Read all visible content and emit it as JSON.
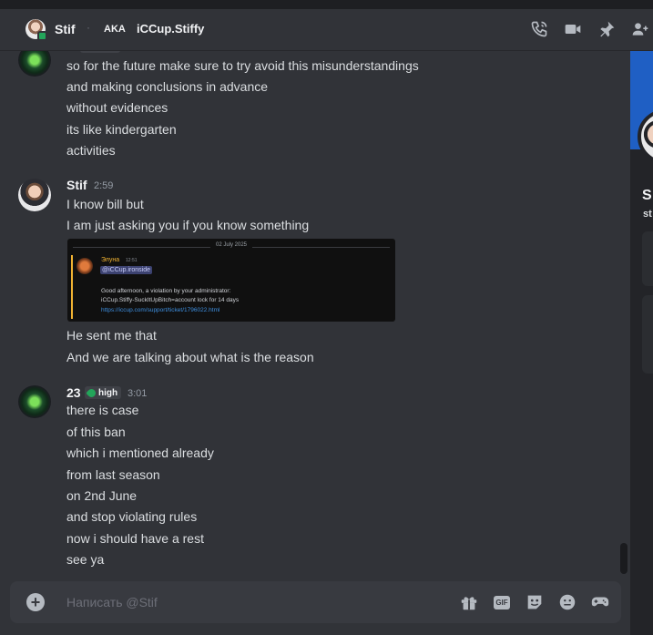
{
  "header": {
    "name": "Stif",
    "separator": "·",
    "aka": "AKA",
    "nickname": "iCCup.Stiffy",
    "icons": [
      "call-icon",
      "video-call-icon",
      "pin-icon",
      "add-friends-icon"
    ]
  },
  "chat": {
    "earlier_lines": [
      "so for the future make sure to try avoid this misunderstandings",
      "and making conclusions in advance",
      "without evidences",
      "its like kindergarten",
      "activities"
    ],
    "stif_message": {
      "author": "Stif",
      "time": "2:59",
      "lines": [
        "I know bill but",
        "I am just asking you if you know something"
      ],
      "embed": {
        "date": "02 July 2025",
        "name": "Элуна",
        "time": "12:51",
        "mention": "@iCCup.ironside",
        "text": [
          "Good afternoon, a violation by your administrator:",
          "iCCup.Stiffy-SuckItUpBitch=account lock for 14 days"
        ],
        "link": "https://iccup.com/support/ticket/1796022.html"
      },
      "after_lines": [
        "He sent me that",
        "And we are talking about what is the reason"
      ]
    },
    "user23_message": {
      "author": "23",
      "badge": "high",
      "time": "3:01",
      "lines": [
        "there is case",
        "of this ban",
        "which i mentioned already",
        "from last season",
        "on 2nd June",
        "and stop violating rules",
        "now i should have a rest",
        "see ya"
      ]
    }
  },
  "composer": {
    "placeholder": "Написать @Stif",
    "icons": [
      "gift-icon",
      "gif-icon",
      "sticker-icon",
      "emoji-icon",
      "activities-icon"
    ],
    "gif_label": "GIF"
  },
  "profile_panel": {
    "name_fragment": "S",
    "handle_fragment": "st"
  },
  "colors": {
    "background": "#313338",
    "accent_banner": "#1f5fc4",
    "online": "#23a55a",
    "link": "#3e8fe0"
  }
}
